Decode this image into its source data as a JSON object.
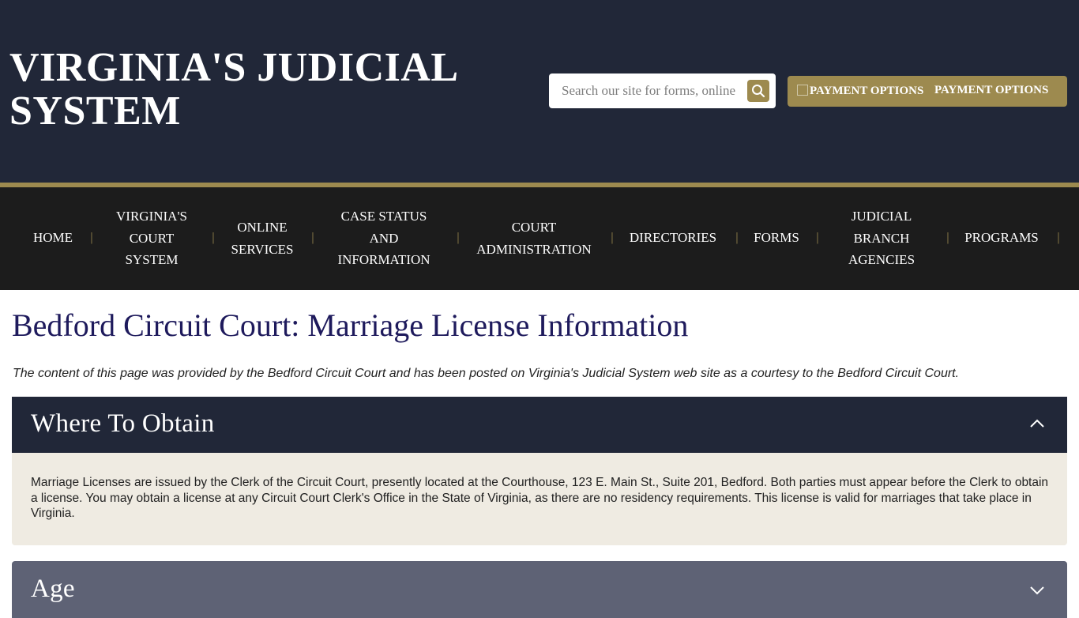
{
  "header": {
    "site_title_line1": "VIRGINIA'S JUDICIAL",
    "site_title_line2": "SYSTEM",
    "search_placeholder": "Search our site for forms, online services...",
    "search_icon": "search-icon",
    "payment_alt": "PAYMENT OPTIONS",
    "payment_label": "PAYMENT OPTIONS"
  },
  "nav": {
    "items": [
      {
        "lines": [
          "HOME"
        ]
      },
      {
        "lines": [
          "VIRGINIA'S",
          "COURT",
          "SYSTEM"
        ]
      },
      {
        "lines": [
          "ONLINE",
          "SERVICES"
        ]
      },
      {
        "lines": [
          "CASE STATUS",
          "AND",
          "INFORMATION"
        ]
      },
      {
        "lines": [
          "COURT",
          "ADMINISTRATION"
        ]
      },
      {
        "lines": [
          "DIRECTORIES"
        ]
      },
      {
        "lines": [
          "FORMS"
        ]
      },
      {
        "lines": [
          "JUDICIAL",
          "BRANCH",
          "AGENCIES"
        ]
      },
      {
        "lines": [
          "PROGRAMS"
        ]
      }
    ],
    "separator": "|"
  },
  "main": {
    "page_title": "Bedford Circuit Court: Marriage License Information",
    "courtesy_note": "The content of this page was provided by the Bedford Circuit Court and has been posted on Virginia's Judicial System web site as a courtesy to the Bedford Circuit Court.",
    "accordion": [
      {
        "title": "Where To Obtain",
        "expanded": true,
        "icon": "chevron-up-icon",
        "body": "Marriage Licenses are issued by the Clerk of the Circuit Court, presently located at the Courthouse, 123 E. Main St., Suite 201, Bedford. Both parties must appear before the Clerk to obtain a license. You may obtain a license at any Circuit Court Clerk's Office in the State of Virginia, as there are no residency requirements. This license is valid for marriages that take place in Virginia."
      },
      {
        "title": "Age",
        "expanded": false,
        "icon": "chevron-down-icon"
      }
    ]
  },
  "colors": {
    "header_bg": "#212738",
    "gold": "#9d8a4f",
    "nav_bg": "#1c1c1c",
    "title_color": "#1e1a5c",
    "panel_bg": "#efebe2",
    "collapsed_bg": "#5e6275"
  }
}
